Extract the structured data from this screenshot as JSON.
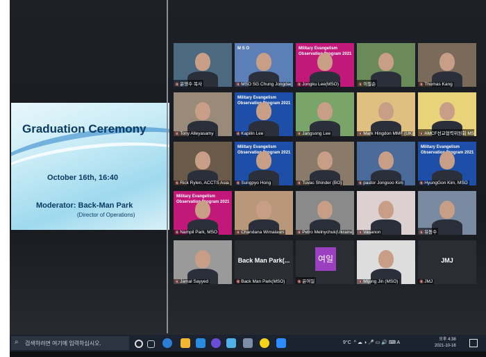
{
  "slide": {
    "title": "Graduation Ceremony",
    "date": "October 16th, 16:40",
    "moderator": "Moderator: Back-Man Park",
    "role": "(Director of Operations)"
  },
  "participants": [
    {
      "name": "윤영수 목사"
    },
    {
      "name": "MSO SG Chung Jongdae",
      "banner": "M S O"
    },
    {
      "name": "Jongku Lee(MSO)",
      "banner": "Military Evangelism Observation Program 2021"
    },
    {
      "name": "이필순"
    },
    {
      "name": "Thomas Kang"
    },
    {
      "name": "Tony Alleyasamy"
    },
    {
      "name": "Kapilin Lee",
      "banner": "Military Evangelism Observation Program 2021"
    },
    {
      "name": "Jangsong Lee"
    },
    {
      "name": "Mark Hingdon MMF (UK)"
    },
    {
      "name": "AMCF선교협력위원회 MSO"
    },
    {
      "name": "Rick Rylen, ACCTS Asia (USA)"
    },
    {
      "name": "Sungpyo Hong",
      "banner": "Military Evangelism Observation Program 2021"
    },
    {
      "name": "Tuvac Shinder (BO)"
    },
    {
      "name": "pastor Jongsoo Kim"
    },
    {
      "name": "HyungGon Kim, MSO",
      "banner": "Military Evangelism Observation Program 2021"
    },
    {
      "name": "Nampil Park, MSO",
      "banner": "Military Evangelism Observation Program 2021"
    },
    {
      "name": "Chandana Wimalasiri"
    },
    {
      "name": "Petro Melnychuk(Ukraine)"
    },
    {
      "name": "Vasanon"
    },
    {
      "name": "유동수"
    },
    {
      "name": "Jamal Sayyed"
    },
    {
      "name": "Back Man Park(MSO)",
      "bigtext": "Back Man Park(..."
    },
    {
      "name": "윤여일",
      "ktext": "여일"
    },
    {
      "name": "Mijung Jin (MSO)"
    },
    {
      "name": "JMJ",
      "bigtext": "JMJ"
    }
  ],
  "taskbar": {
    "search_placeholder": "검색하려면 여기에 입력하십시오.",
    "weather": "9°C",
    "time": "오후 4:38",
    "date": "2021-10-16",
    "lang": "A"
  },
  "colors": {
    "banner_magenta": "#c2187a",
    "banner_blue": "#1e4fa8",
    "taskbar": "#1b2230"
  }
}
